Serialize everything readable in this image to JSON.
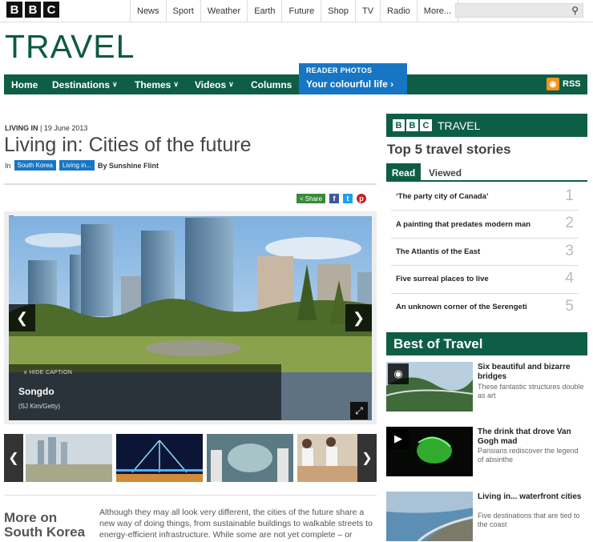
{
  "topnav": [
    "News",
    "Sport",
    "Weather",
    "Earth",
    "Future",
    "Shop",
    "TV",
    "Radio",
    "More..."
  ],
  "logo_letters": [
    "B",
    "B",
    "C"
  ],
  "section_title": "TRAVEL",
  "mainnav": {
    "home": "Home",
    "destinations": "Destinations",
    "themes": "Themes",
    "videos": "Videos",
    "columns": "Columns",
    "reader_top": "READER PHOTOS",
    "reader_bottom": "Your colourful life",
    "rss": "RSS"
  },
  "article": {
    "kicker_section": "LIVING IN",
    "kicker_date": "| 19 June 2013",
    "headline": "Living in: Cities of the future",
    "byline_in": "In",
    "tag1": "South Korea",
    "tag2": "Living in...",
    "byline_author": "By Sunshine Flint",
    "share_label": "Share",
    "hide_caption": "HIDE CAPTION",
    "caption_title": "Songdo",
    "caption_credit": "(SJ Kim/Getty)",
    "more_on": "More on South Korea",
    "intro": "Although they may all look very different, the cities of the future share a new way of doing things, from sustainable buildings to walkable streets to energy-efficient infrastructure. While some are not yet complete – or"
  },
  "sidebar": {
    "banner_text": "TRAVEL",
    "top5_title": "Top 5 travel stories",
    "tab_read": "Read",
    "tab_viewed": "Viewed",
    "stories": [
      {
        "title": "‘The party city of Canada’",
        "num": "1"
      },
      {
        "title": "A painting that predates modern man",
        "num": "2"
      },
      {
        "title": "The Atlantis of the East",
        "num": "3"
      },
      {
        "title": "Five surreal places to live",
        "num": "4"
      },
      {
        "title": "An unknown corner of the Serengeti",
        "num": "5"
      }
    ],
    "best_title": "Best of Travel",
    "best": [
      {
        "title": "Six beautiful and bizarre bridges",
        "desc": "These fantastic structures double as art"
      },
      {
        "title": "The drink that drove Van Gogh mad",
        "desc": "Parisians rediscover the legend of absinthe"
      },
      {
        "title": "Living in... waterfront cities",
        "desc": "Five destinations that are tied to the coast"
      }
    ]
  }
}
